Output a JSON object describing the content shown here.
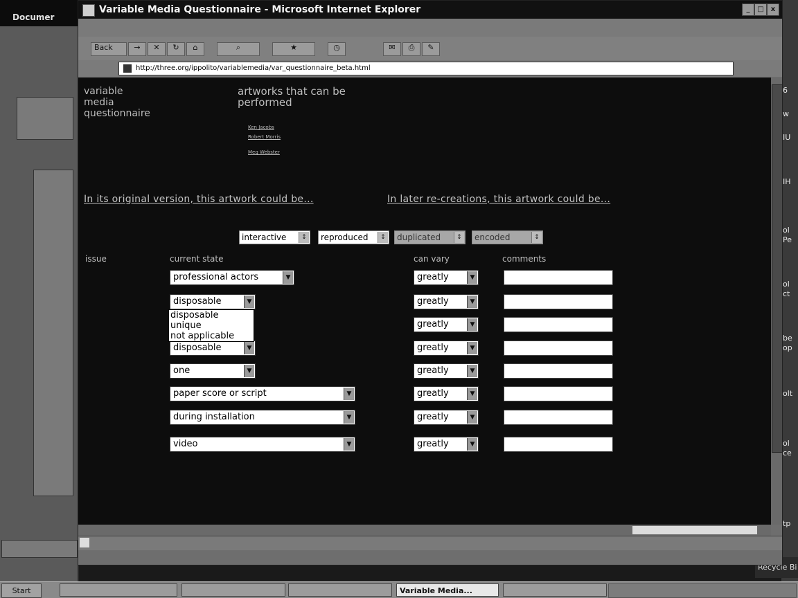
{
  "background_window": {
    "title": "Documer"
  },
  "desktop": {
    "recycle_label": "Recycle Bi",
    "right_labels": [
      "6",
      "w",
      "IU",
      "IH",
      "ol",
      "Pe",
      "ol",
      "ct",
      "be",
      "op",
      "olt",
      "ol",
      "ce",
      "tp"
    ]
  },
  "browser": {
    "title": "Variable Media Questionnaire - Microsoft Internet Explorer",
    "toolbar": {
      "back_label": "Back",
      "forward_label": "→",
      "stop_label": "✕",
      "refresh_label": "↻",
      "home_label": "⌂",
      "search_label": "⌕",
      "favorites_label": "★",
      "history_label": "◷",
      "mail_label": "✉",
      "print_label": "⎙",
      "edit_label": "✎"
    },
    "address": "http://three.org/ippolito/variablemedia/var_questionnaire_beta.html"
  },
  "page": {
    "logo_lines": [
      "variable",
      "media",
      "questionnaire"
    ],
    "heading_lines": [
      "artworks that can be",
      "performed"
    ],
    "author_links": [
      "Ken Jacobs",
      "Robert Morris",
      "Meg Webster"
    ],
    "original_heading": "In its original version, this artwork could be...",
    "later_heading": "In later re-creations, this artwork could be...",
    "filters": [
      {
        "label": "interactive",
        "arrow": "↕"
      },
      {
        "label": "reproduced",
        "arrow": "↕"
      },
      {
        "label": "duplicated",
        "arrow": "↕"
      },
      {
        "label": "encoded",
        "arrow": "↕"
      }
    ],
    "columns": {
      "issue": "issue",
      "current_state": "current state",
      "can_vary": "can vary",
      "comments": "comments"
    },
    "rows": [
      {
        "state": "professional actors",
        "vary": "greatly"
      },
      {
        "state": "disposable",
        "vary": "greatly"
      },
      {
        "state": "",
        "vary": "greatly"
      },
      {
        "state": "disposable",
        "vary": "greatly"
      },
      {
        "state": "one",
        "vary": "greatly"
      },
      {
        "state": "paper score or script",
        "vary": "greatly"
      },
      {
        "state": "during installation",
        "vary": "greatly"
      },
      {
        "state": "video",
        "vary": "greatly"
      }
    ],
    "dropdown_options": [
      "disposable",
      "unique",
      "not applicable"
    ]
  },
  "taskbar": {
    "start_label": "Start",
    "active_task": "Variable Media..."
  }
}
